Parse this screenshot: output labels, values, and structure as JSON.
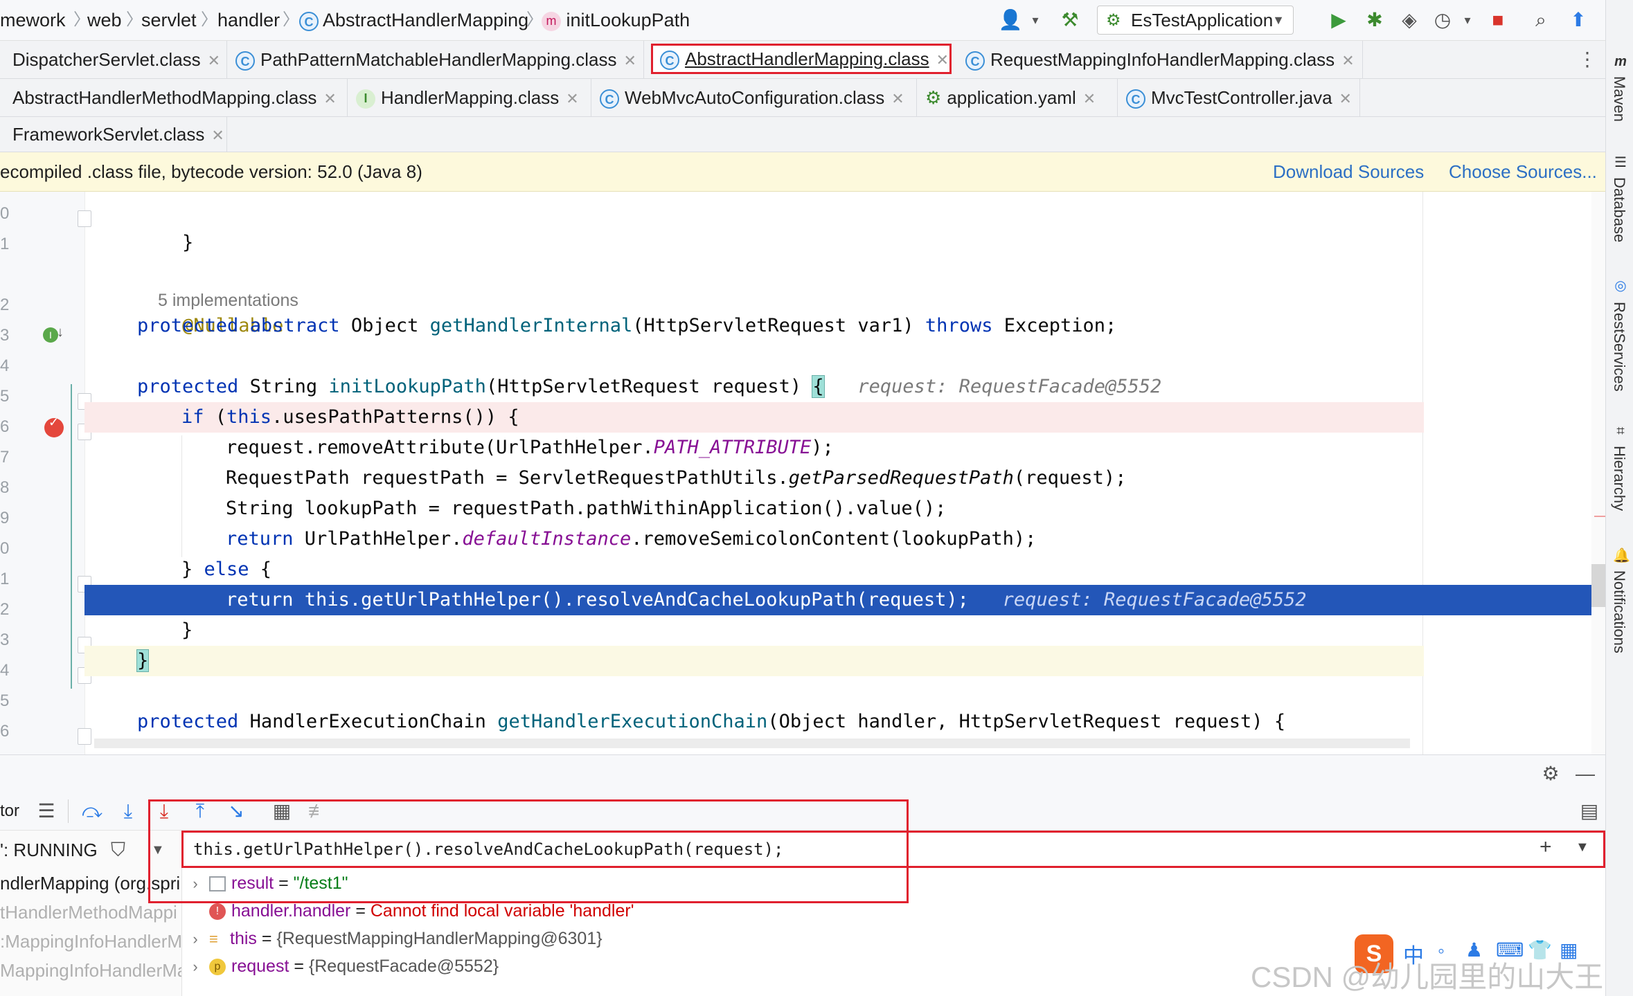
{
  "breadcrumb": {
    "items": [
      "mework",
      "web",
      "servlet",
      "handler",
      "AbstractHandlerMapping",
      "initLookupPath"
    ]
  },
  "run_config": {
    "name": "EsTestApplication"
  },
  "tabs": {
    "row1": [
      {
        "label": "DispatcherServlet.class"
      },
      {
        "label": "PathPatternMatchableHandlerMapping.class"
      },
      {
        "label": "AbstractHandlerMapping.class",
        "active": true
      },
      {
        "label": "RequestMappingInfoHandlerMapping.class"
      }
    ],
    "row2": [
      {
        "label": "AbstractHandlerMethodMapping.class"
      },
      {
        "label": "HandlerMapping.class"
      },
      {
        "label": "WebMvcAutoConfiguration.class"
      },
      {
        "label": "application.yaml"
      },
      {
        "label": "MvcTestController.java"
      }
    ],
    "row3": [
      {
        "label": "FrameworkServlet.class"
      }
    ]
  },
  "banner": {
    "text": "ecompiled .class file, bytecode version: 52.0 (Java 8)",
    "download_sources": "Download Sources",
    "choose_sources": "Choose Sources..."
  },
  "editor": {
    "line_numbers": [
      "0",
      "1",
      "",
      "2",
      "3",
      "4",
      "5",
      "6",
      "7",
      "8",
      "9",
      "0",
      "1",
      "2",
      "3",
      "4",
      "5",
      "6"
    ],
    "implementations_hint": "5 implementations",
    "annotation": "@Nullable",
    "code": {
      "l_close": "}",
      "abstract_kw1": "protected",
      "abstract_kw2": "abstract",
      "abstract_type": " Object ",
      "abstract_fn": "getHandlerInternal",
      "abstract_args": "(HttpServletRequest var1) ",
      "abstract_throws": "throws",
      "abstract_tail": " Exception;",
      "m_kw": "protected",
      "m_type": " String ",
      "m_fn": "initLookupPath",
      "m_args": "(HttpServletRequest request) ",
      "m_brace": "{",
      "m_hint": "request: RequestFacade@5552",
      "if_kw": "if",
      "if_open": " (",
      "if_this": "this",
      "if_rest": ".usesPathPatterns()) {",
      "l1_a": "request.removeAttribute(UrlPathHelper.",
      "l1_b": "PATH_ATTRIBUTE",
      "l1_c": ");",
      "l2_a": "RequestPath requestPath = ServletRequestPathUtils.",
      "l2_b": "getParsedRequestPath",
      "l2_c": "(request);",
      "l3": "String lookupPath = requestPath.pathWithinApplication().value();",
      "l4_kw": "return",
      "l4_a": " UrlPathHelper.",
      "l4_b": "defaultInstance",
      "l4_c": ".removeSemicolonContent(lookupPath);",
      "else_a": "} ",
      "else_kw": "else",
      "else_b": " {",
      "exec_kw": "return",
      "exec_rest": " this.getUrlPathHelper().resolveAndCacheLookupPath(request);",
      "exec_hint": "request: RequestFacade@5552",
      "inner_close": "}",
      "method_close": "}",
      "next_kw": "protected",
      "next_type": " HandlerExecutionChain ",
      "next_fn": "getHandlerExecutionChain",
      "next_args": "(Object handler, HttpServletRequest request) {"
    }
  },
  "debug": {
    "left_label": "tor",
    "thread_status": "': RUNNING",
    "frames": [
      "ndlerMapping (org.spri",
      "tHandlerMethodMappi",
      ":MappingInfoHandlerM",
      "MappingInfoHandlerMa"
    ],
    "expression": "this.getUrlPathHelper().resolveAndCacheLookupPath(request);",
    "variables": [
      {
        "name": "result",
        "eq": " = ",
        "value": "\"/test1\""
      },
      {
        "name": "handler.handler",
        "eq": " = ",
        "value": "Cannot find local variable 'handler'"
      },
      {
        "name": "this",
        "eq": " = ",
        "value": "{RequestMappingHandlerMapping@6301}"
      },
      {
        "name": "request",
        "eq": " = ",
        "value": "{RequestFacade@5552}"
      }
    ]
  },
  "right_strip": [
    "Maven",
    "Database",
    "RestServices",
    "Hierarchy",
    "Notifications"
  ],
  "ime": {
    "label": "中"
  },
  "watermark": "CSDN @幼儿园里的山大王",
  "colors": {
    "accent_red": "#e0202e",
    "exec_line": "#2356b8",
    "keyword": "#0033b3",
    "link": "#2c6fc4"
  }
}
